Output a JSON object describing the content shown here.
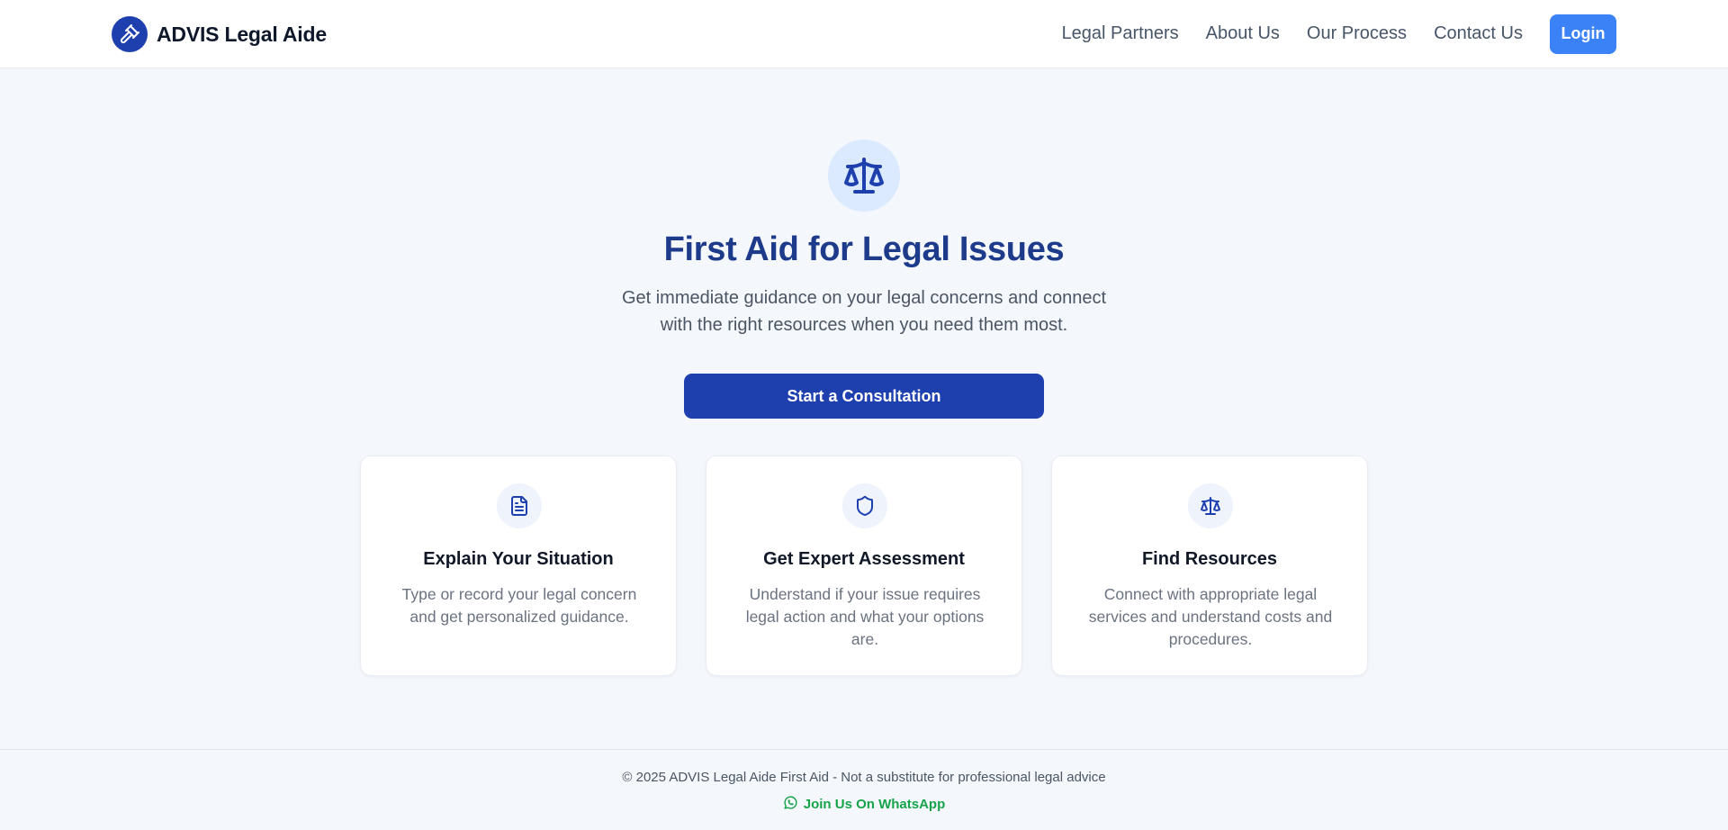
{
  "header": {
    "brand_name": "ADVIS Legal Aide",
    "nav": [
      "Legal Partners",
      "About Us",
      "Our Process",
      "Contact Us"
    ],
    "login_label": "Login"
  },
  "hero": {
    "title": "First Aid for Legal Issues",
    "subtitle": "Get immediate guidance on your legal concerns and connect with the right resources when you need them most.",
    "cta_label": "Start a Consultation",
    "icon": "scale-icon"
  },
  "cards": [
    {
      "icon": "document-icon",
      "title": "Explain Your Situation",
      "text": "Type or record your legal concern and get personalized guidance."
    },
    {
      "icon": "shield-icon",
      "title": "Get Expert Assessment",
      "text": "Understand if your issue requires legal action and what your options are."
    },
    {
      "icon": "scale-icon",
      "title": "Find Resources",
      "text": "Connect with appropriate legal services and understand costs and procedures."
    }
  ],
  "footer": {
    "copyright": "© 2025 ADVIS Legal Aide First Aid - Not a substitute for professional legal advice",
    "whatsapp_label": "Join Us On WhatsApp"
  },
  "colors": {
    "primary": "#1e40af",
    "accent": "#3b82f6",
    "title": "#1e3a8a",
    "whatsapp": "#16a34a",
    "background": "#f4f7fc"
  }
}
